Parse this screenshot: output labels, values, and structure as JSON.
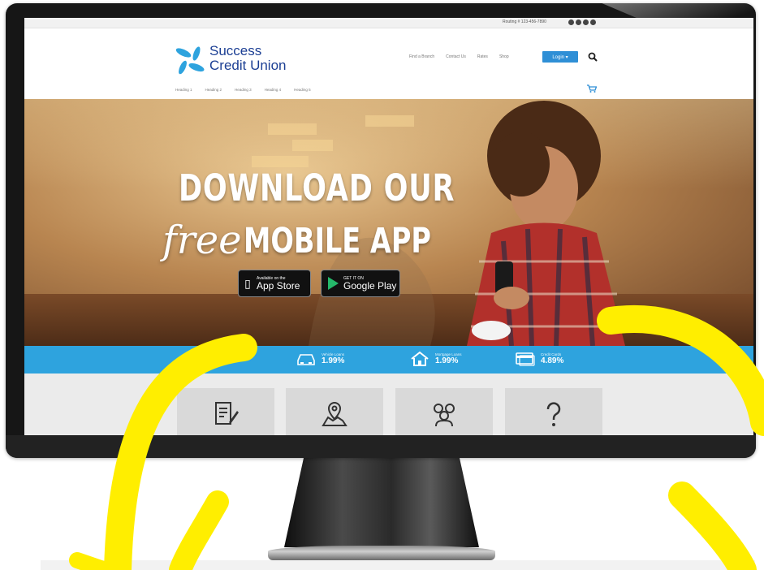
{
  "topbar": {
    "text": "Routing # 123-456-7890"
  },
  "logo": {
    "line1": "Success",
    "line2": "Credit Union"
  },
  "nav": {
    "items": [
      "Find a Branch",
      "Contact Us",
      "Rates",
      "Shop"
    ],
    "login_label": "Login ▾"
  },
  "subnav": {
    "items": [
      "Heading 1",
      "Heading 2",
      "Heading 3",
      "Heading 4",
      "Heading 5"
    ]
  },
  "hero": {
    "line1": "DOWNLOAD OUR",
    "line2_script": "free",
    "line2": "MOBILE APP",
    "apple_small": "Available on the",
    "apple_big": "App Store",
    "google_small": "GET IT ON",
    "google_big": "Google Play"
  },
  "rates": [
    {
      "label": "Vehicle Loans",
      "value": "1.99%",
      "icon": "car-icon"
    },
    {
      "label": "Mortgage Loans",
      "value": "1.99%",
      "icon": "house-icon"
    },
    {
      "label": "Credit Cards",
      "value": "4.89%",
      "icon": "credit-card-icon"
    }
  ],
  "tiles": [
    {
      "icon": "document-edit-icon"
    },
    {
      "icon": "map-location-icon"
    },
    {
      "icon": "people-group-icon"
    },
    {
      "icon": "question-icon"
    }
  ],
  "colors": {
    "brand_blue": "#1c3f94",
    "accent_blue": "#2ea3de",
    "highlight_yellow": "#ffee00"
  }
}
